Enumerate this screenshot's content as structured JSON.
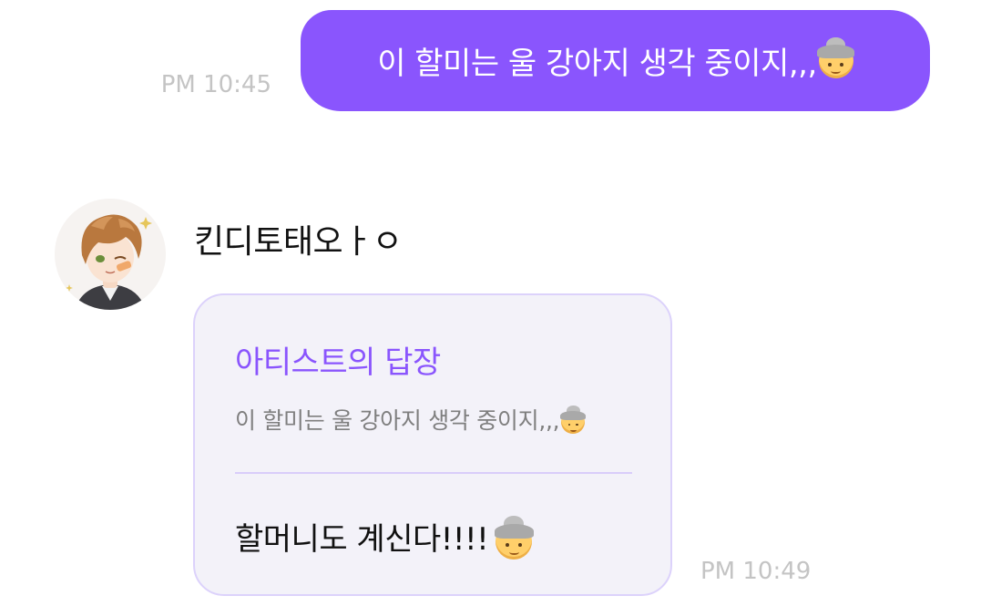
{
  "outgoing": {
    "time": "PM 10:45",
    "text": "이 할미는 울 강아지 생각 중이지,,,",
    "emoji": "older-woman-emoji"
  },
  "incoming": {
    "sender_name": "킨디토태오ㅏㅇ",
    "avatar": "artist-avatar",
    "reply_label": "아티스트의 답장",
    "quoted_text": "이 할미는 울 강아지 생각 중이지,,,",
    "quoted_emoji": "older-woman-emoji",
    "reply_text": "할머니도 계신다!!!!",
    "reply_emoji": "older-woman-emoji",
    "time": "PM 10:49"
  },
  "colors": {
    "accent": "#8a55fd",
    "card_background": "#f3f2f9",
    "card_border": "#dcd2fb",
    "timestamp": "#c4c4c4"
  }
}
